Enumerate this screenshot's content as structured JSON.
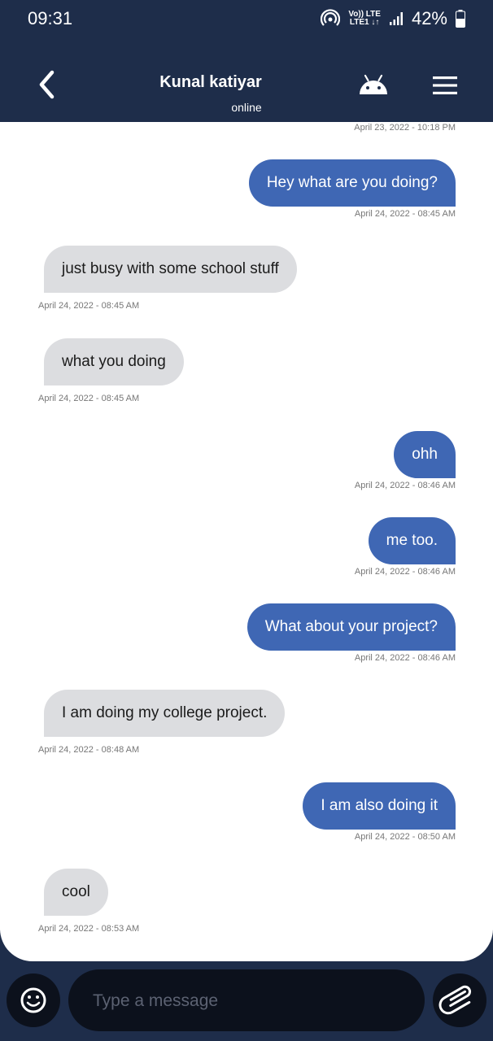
{
  "status_bar": {
    "time": "09:31",
    "network_top": "Vo)) LTE",
    "network_bottom": "LTE1 ↓↑",
    "battery": "42%"
  },
  "header": {
    "contact_name": "Kunal katiyar",
    "status": "online",
    "back_icon": "chevron-left-icon",
    "android_icon": "android-icon",
    "menu_icon": "hamburger-menu-icon"
  },
  "messages": [
    {
      "direction": "out",
      "text": "",
      "time": "April 23, 2022 - 10:18 PM"
    },
    {
      "direction": "out",
      "text": "Hey what are you doing?",
      "time": "April 24, 2022 - 08:45 AM"
    },
    {
      "direction": "in",
      "text": "just busy with some school stuff",
      "time": "April 24, 2022 - 08:45 AM"
    },
    {
      "direction": "in",
      "text": "what you doing",
      "time": "April 24, 2022 - 08:45 AM"
    },
    {
      "direction": "out",
      "text": "ohh",
      "time": "April 24, 2022 - 08:46 AM"
    },
    {
      "direction": "out",
      "text": "me too.",
      "time": "April 24, 2022 - 08:46 AM"
    },
    {
      "direction": "out",
      "text": "What about your project?",
      "time": "April 24, 2022 - 08:46 AM"
    },
    {
      "direction": "in",
      "text": "I am doing my college project.",
      "time": "April 24, 2022 - 08:48 AM"
    },
    {
      "direction": "out",
      "text": "I am also doing it",
      "time": "April 24, 2022 - 08:50 AM"
    },
    {
      "direction": "in",
      "text": "cool",
      "time": "April 24, 2022 - 08:53 AM"
    }
  ],
  "composer": {
    "placeholder": "Type a message",
    "emoji_icon": "emoji-icon",
    "attach_icon": "paperclip-icon"
  },
  "colors": {
    "header_bg": "#1e2d4a",
    "outgoing_bubble": "#3f67b4",
    "incoming_bubble": "#dcdde0"
  }
}
